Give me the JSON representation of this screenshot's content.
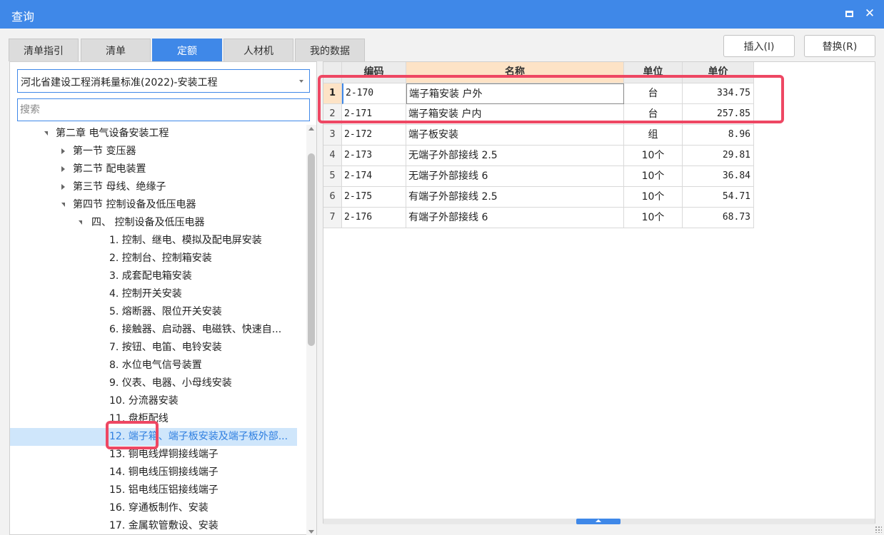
{
  "window": {
    "title": "查询",
    "maximize_icon": "maximize-icon",
    "close_icon": "close-icon",
    "close_glyph": "✕"
  },
  "tabs": [
    {
      "label": "清单指引",
      "active": false
    },
    {
      "label": "清单",
      "active": false
    },
    {
      "label": "定额",
      "active": true
    },
    {
      "label": "人材机",
      "active": false
    },
    {
      "label": "我的数据",
      "active": false
    }
  ],
  "actions": {
    "insert_label": "插入(I)",
    "replace_label": "替换(R)"
  },
  "standard_select": {
    "value": "河北省建设工程消耗量标准(2022)-安装工程"
  },
  "search": {
    "placeholder": "搜索"
  },
  "tree": [
    {
      "label": "第二章 电气设备安装工程",
      "expanded": true
    },
    {
      "label": "第一节 变压器",
      "expanded": false
    },
    {
      "label": "第二节 配电装置",
      "expanded": false
    },
    {
      "label": "第三节 母线、绝缘子",
      "expanded": false
    },
    {
      "label": "第四节 控制设备及低压电器",
      "expanded": true
    },
    {
      "label": "四、 控制设备及低压电器",
      "expanded": true
    },
    {
      "label": "1. 控制、继电、模拟及配电屏安装"
    },
    {
      "label": "2. 控制台、控制箱安装"
    },
    {
      "label": "3. 成套配电箱安装"
    },
    {
      "label": "4. 控制开关安装"
    },
    {
      "label": "5. 熔断器、限位开关安装"
    },
    {
      "label": "6. 接触器、启动器、电磁铁、快速自..."
    },
    {
      "label": "7. 按钮、电笛、电铃安装"
    },
    {
      "label": "8. 水位电气信号装置"
    },
    {
      "label": "9. 仪表、电器、小母线安装"
    },
    {
      "label": "10. 分流器安装"
    },
    {
      "label": "11. 盘柜配线"
    },
    {
      "label": "12. 端子箱、端子板安装及端子板外部...",
      "selected": true
    },
    {
      "label": "13. 铜电线焊铜接线端子"
    },
    {
      "label": "14. 铜电线压铜接线端子"
    },
    {
      "label": "15. 铝电线压铝接线端子"
    },
    {
      "label": "16. 穿通板制作、安装"
    },
    {
      "label": "17. 金属软管敷设、安装"
    }
  ],
  "table": {
    "headers": {
      "code": "编码",
      "name": "名称",
      "unit": "单位",
      "price": "单价"
    },
    "rows": [
      {
        "num": "1",
        "code": "2-170",
        "name": "端子箱安装 户外",
        "unit": "台",
        "price": "334.75"
      },
      {
        "num": "2",
        "code": "2-171",
        "name": "端子箱安装 户内",
        "unit": "台",
        "price": "257.85"
      },
      {
        "num": "3",
        "code": "2-172",
        "name": "端子板安装",
        "unit": "组",
        "price": "8.96"
      },
      {
        "num": "4",
        "code": "2-173",
        "name": "无端子外部接线 2.5",
        "unit": "10个",
        "price": "29.81"
      },
      {
        "num": "5",
        "code": "2-174",
        "name": "无端子外部接线 6",
        "unit": "10个",
        "price": "36.84"
      },
      {
        "num": "6",
        "code": "2-175",
        "name": "有端子外部接线 2.5",
        "unit": "10个",
        "price": "54.71"
      },
      {
        "num": "7",
        "code": "2-176",
        "name": "有端子外部接线 6",
        "unit": "10个",
        "price": "68.73"
      }
    ]
  },
  "colors": {
    "accent": "#3f88e8",
    "highlight": "#ee4763",
    "selected_row": "#cfe6fb"
  }
}
